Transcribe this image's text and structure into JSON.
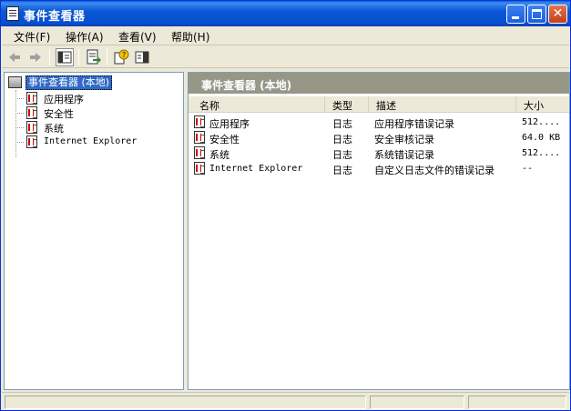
{
  "window": {
    "title": "事件查看器"
  },
  "menu": [
    "文件(F)",
    "操作(A)",
    "查看(V)",
    "帮助(H)"
  ],
  "tree": {
    "root": "事件查看器 (本地)",
    "children": [
      "应用程序",
      "安全性",
      "系统",
      "Internet Explorer"
    ]
  },
  "right": {
    "header": "事件查看器 (本地)",
    "columns": [
      "名称",
      "类型",
      "描述",
      "大小"
    ],
    "rows": [
      {
        "name": "应用程序",
        "type": "日志",
        "desc": "应用程序错误记录",
        "size": "512...."
      },
      {
        "name": "安全性",
        "type": "日志",
        "desc": "安全审核记录",
        "size": "64.0 KB"
      },
      {
        "name": "系统",
        "type": "日志",
        "desc": "系统错误记录",
        "size": "512...."
      },
      {
        "name": "Internet Explorer",
        "type": "日志",
        "desc": "自定义日志文件的错误记录",
        "size": "--"
      }
    ]
  },
  "colors": {
    "titlebar": "#0b57d6",
    "selection": "#316ac5",
    "pane_header": "#979788"
  }
}
